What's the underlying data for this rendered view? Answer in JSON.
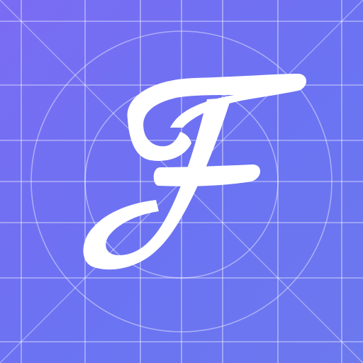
{
  "app_icon": {
    "semantic": "font-app-icon",
    "glyph_icon": "script-letter-f-icon",
    "background_colors": [
      "#7a6cf3",
      "#6b73f2",
      "#6c78ee"
    ],
    "grid_color": "#ffffff",
    "glyph_color": "#ffffff"
  }
}
